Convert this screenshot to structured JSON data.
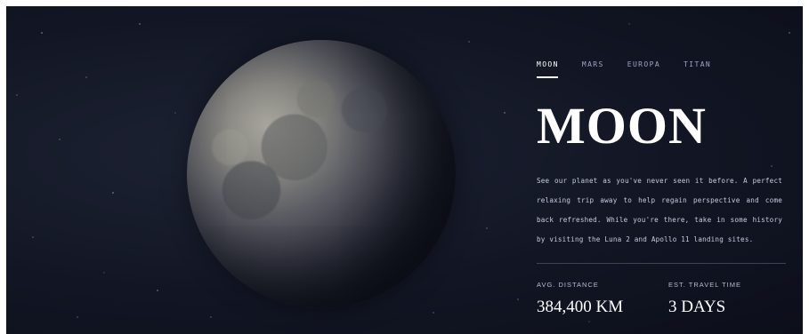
{
  "nav": {
    "tabs": [
      {
        "label": "MOON",
        "active": true
      },
      {
        "label": "MARS",
        "active": false
      },
      {
        "label": "EUROPA",
        "active": false
      },
      {
        "label": "TITAN",
        "active": false
      }
    ]
  },
  "destination": {
    "name": "MOON",
    "description": "See our planet as you've never seen it before. A perfect relaxing trip away to help regain perspective and come back refreshed. While you're there, take in some history by visiting the Luna 2 and Apollo 11 landing sites."
  },
  "stats": {
    "distance_label": "AVG. DISTANCE",
    "distance_value": "384,400 KM",
    "travel_label": "EST. TRAVEL TIME",
    "travel_value": "3 DAYS"
  },
  "colors": {
    "background": "#121624",
    "text_primary": "#ffffff",
    "text_secondary": "#c7cbe0"
  }
}
